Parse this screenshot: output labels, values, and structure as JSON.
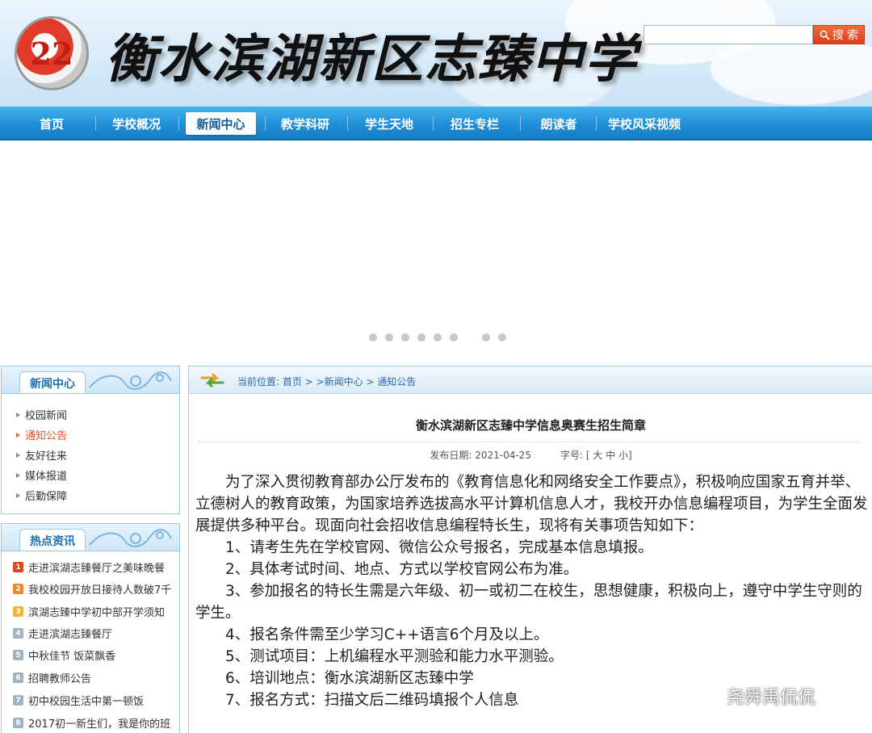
{
  "header": {
    "logo_text": "22",
    "site_title": "衡水滨湖新区志臻中学",
    "search": {
      "value": "",
      "button_label": "搜 索"
    }
  },
  "nav": {
    "items": [
      {
        "label": "首页"
      },
      {
        "label": "学校概况"
      },
      {
        "label": "新闻中心"
      },
      {
        "label": "教学科研"
      },
      {
        "label": "学生天地"
      },
      {
        "label": "招生专栏"
      },
      {
        "label": "朗读者"
      },
      {
        "label": "学校风采视频"
      }
    ],
    "active": "新闻中心"
  },
  "carousel": {
    "slide_count": 8,
    "active_index": 0
  },
  "sidebar": {
    "news_center": {
      "title": "新闻中心",
      "items": [
        {
          "label": "校园新闻"
        },
        {
          "label": "通知公告"
        },
        {
          "label": "友好往来"
        },
        {
          "label": "媒体报道"
        },
        {
          "label": "后勤保障"
        }
      ],
      "active": "通知公告"
    },
    "hot_news": {
      "title": "热点资讯",
      "items": [
        {
          "rank": "1",
          "label": "走进滨湖志臻餐厅之美味晚餐"
        },
        {
          "rank": "2",
          "label": "我校校园开放日接待人数破7千"
        },
        {
          "rank": "3",
          "label": "滨湖志臻中学初中部开学须知"
        },
        {
          "rank": "4",
          "label": "走进滨湖志臻餐厅"
        },
        {
          "rank": "5",
          "label": "中秋佳节 饭菜飘香"
        },
        {
          "rank": "6",
          "label": "招聘教师公告"
        },
        {
          "rank": "7",
          "label": "初中校园生活中第一顿饭"
        },
        {
          "rank": "8",
          "label": "2017初一新生们，我是你的班"
        }
      ]
    }
  },
  "breadcrumb": {
    "text": "当前位置: 首页 > >新闻中心 > 通知公告"
  },
  "article": {
    "title": "衡水滨湖新区志臻中学信息奥赛生招生简章",
    "meta": "发布日期: 2021-04-25　　　字号: [ 大 中 小]",
    "intro": "为了深入贯彻教育部办公厅发布的《教育信息化和网络安全工作要点》，积极响应国家五育并举、立德树人的教育政策，为国家培养选拔高水平计算机信息人才，我校开办信息编程项目，为学生全面发展提供多种平台。现面向社会招收信息编程特长生，现将有关事项告知如下：",
    "items": [
      "1、请考生先在学校官网、微信公众号报名，完成基本信息填报。",
      "2、具体考试时间、地点、方式以学校官网公布为准。",
      "3、参加报名的特长生需是六年级、初一或初二在校生，思想健康，积极向上，遵守中学生守则的学生。",
      "4、报名条件需至少学习C++语言6个月及以上。",
      "5、测试项目：上机编程水平测验和能力水平测验。",
      "6、培训地点：衡水滨湖新区志臻中学",
      "7、报名方式：扫描文后二维码填报个人信息"
    ]
  },
  "watermark": {
    "text": "尧舜禹侃侃"
  }
}
